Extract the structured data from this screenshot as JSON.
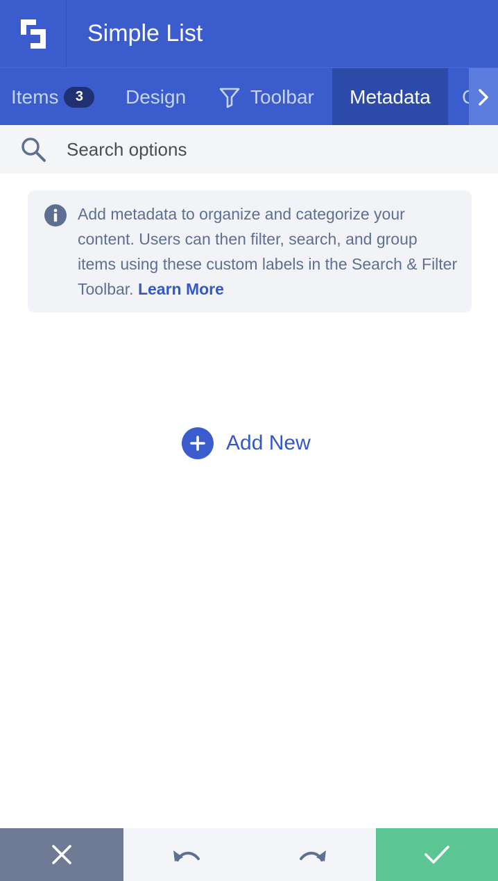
{
  "header": {
    "logo_icon": "logo-icon",
    "title": "Simple List"
  },
  "tabs": {
    "items": [
      {
        "label": "Items",
        "badge": "3"
      },
      {
        "label": "Design"
      },
      {
        "label": "Toolbar",
        "icon": "filter-icon"
      },
      {
        "label": "Metadata",
        "active": true
      },
      {
        "label": "C"
      }
    ],
    "scroll_icon": "chevron-right-icon"
  },
  "search": {
    "placeholder": "Search options",
    "value": "",
    "icon": "search-icon"
  },
  "info": {
    "icon": "info-icon",
    "text": "Add metadata to organize and categorize your content. Users can then filter, search, and group items using these custom labels in the Search & Filter Toolbar.",
    "link_label": "Learn More"
  },
  "add_new": {
    "icon": "plus-circle-icon",
    "label": "Add New"
  },
  "bottom_bar": {
    "cancel_icon": "close-icon",
    "undo_icon": "undo-icon",
    "redo_icon": "redo-icon",
    "confirm_icon": "check-icon"
  },
  "colors": {
    "brand": "#3a5ccc",
    "active_tab": "#2d4aa8",
    "cancel": "#6f7b95",
    "confirm": "#5cc594",
    "link": "#3458c8"
  }
}
